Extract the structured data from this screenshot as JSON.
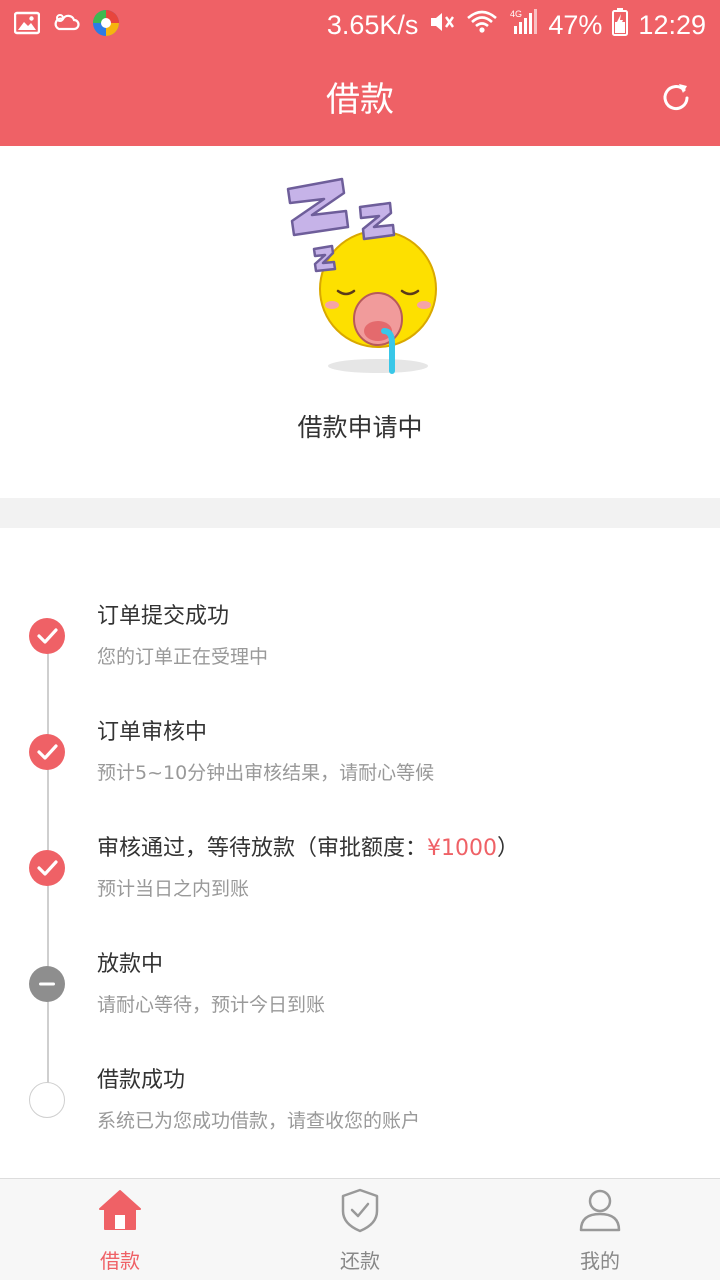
{
  "status_bar": {
    "net_speed": "3.65K/s",
    "battery": "47%",
    "time": "12:29",
    "network_type": "4G"
  },
  "header": {
    "title": "借款"
  },
  "hero": {
    "status_text": "借款申请中"
  },
  "steps": [
    {
      "title": "订单提交成功",
      "desc": "您的订单正在受理中",
      "state": "done"
    },
    {
      "title": "订单审核中",
      "desc": "预计5~10分钟出审核结果，请耐心等候",
      "state": "done"
    },
    {
      "title_prefix": "审核通过，等待放款（审批额度：",
      "amount": "¥1000",
      "title_suffix": "）",
      "desc": "预计当日之内到账",
      "state": "done"
    },
    {
      "title": "放款中",
      "desc": "请耐心等待，预计今日到账",
      "state": "active"
    },
    {
      "title": "借款成功",
      "desc": "系统已为您成功借款，请查收您的账户",
      "state": "pending"
    }
  ],
  "tabs": [
    {
      "label": "借款",
      "icon": "home-icon",
      "active": true
    },
    {
      "label": "还款",
      "icon": "shield-check-icon",
      "active": false
    },
    {
      "label": "我的",
      "icon": "user-icon",
      "active": false
    }
  ],
  "colors": {
    "accent": "#ef6166",
    "active_gray": "#8e8e8e"
  }
}
